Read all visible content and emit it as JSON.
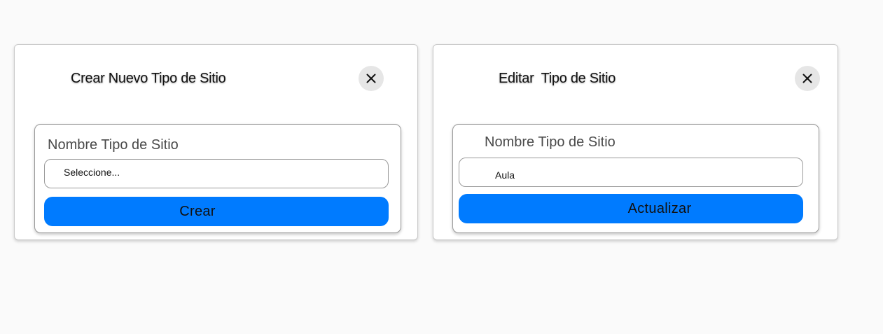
{
  "create_dialog": {
    "title": "Crear Nuevo Tipo de Sitio",
    "close_icon": "close-icon",
    "field_label": "Nombre Tipo de Sitio",
    "input_placeholder": "Seleccione...",
    "submit_label": "Crear"
  },
  "edit_dialog": {
    "title": "Editar  Tipo de Sitio",
    "close_icon": "close-icon",
    "field_label": "Nombre Tipo de Sitio",
    "input_value": "Aula",
    "submit_label": "Actualizar"
  },
  "colors": {
    "primary_button": "#007bff",
    "close_button_bg": "#e6e6e6",
    "page_background": "#fafafa"
  }
}
